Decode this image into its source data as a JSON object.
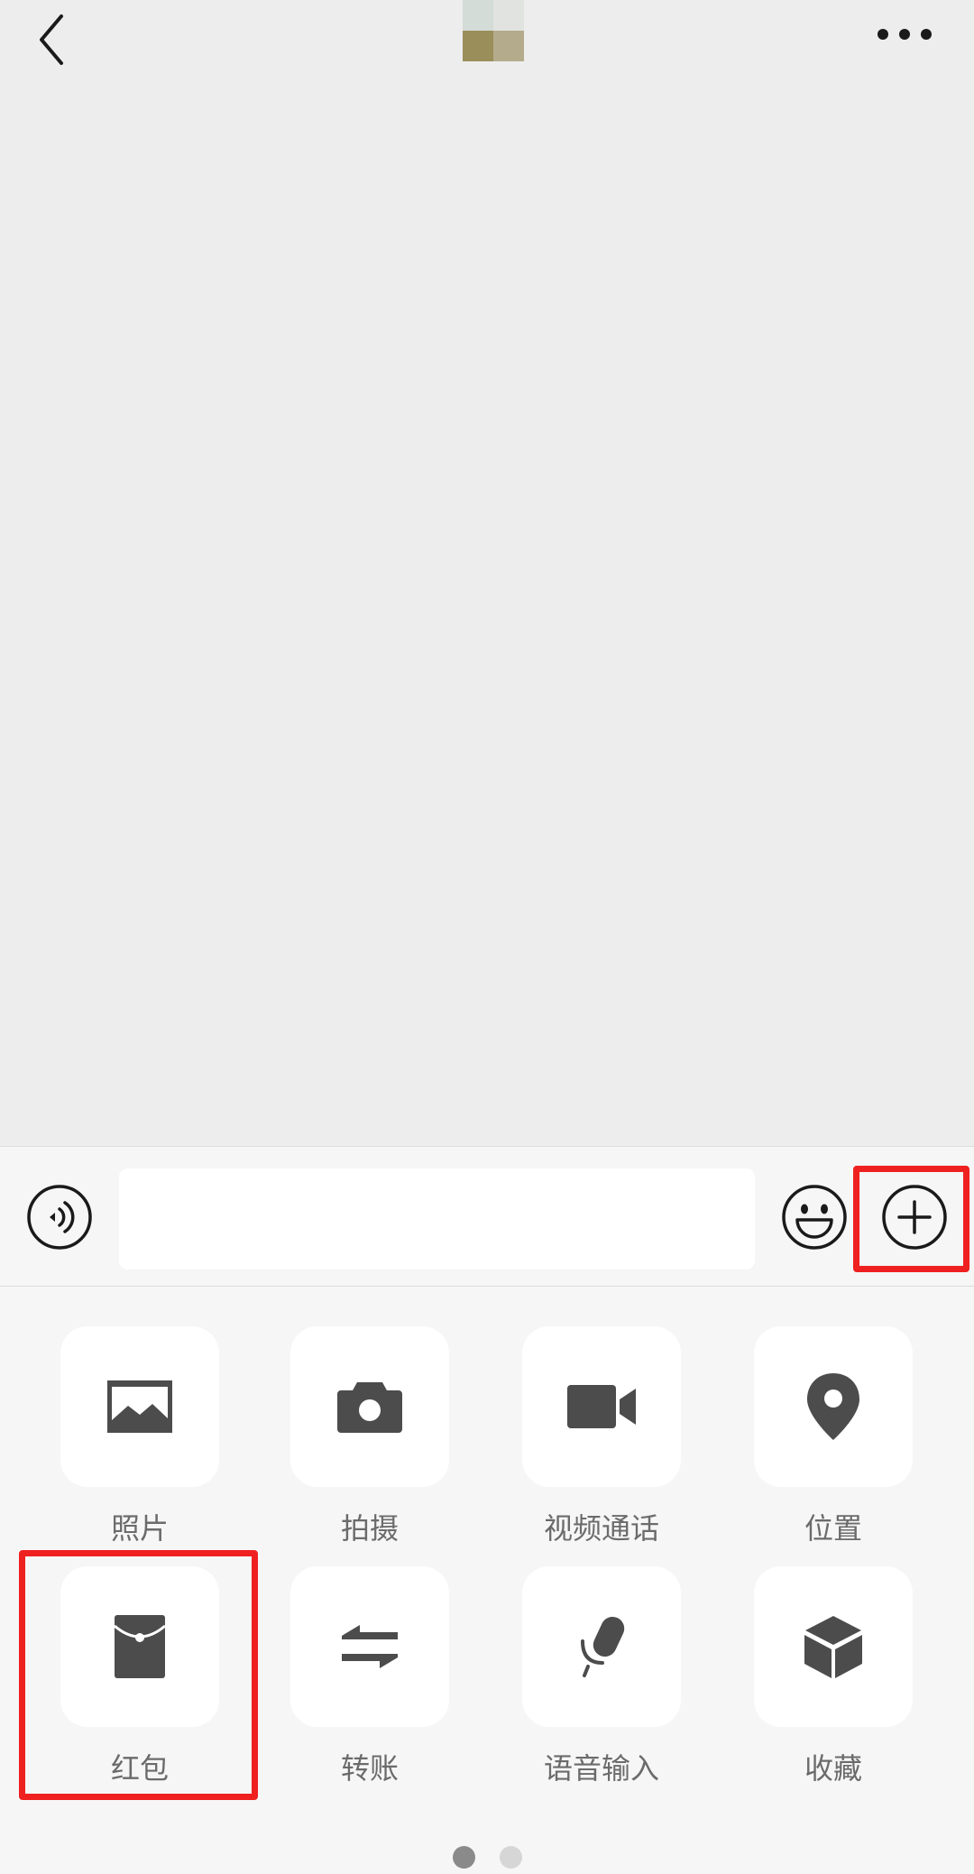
{
  "nav": {
    "back_icon": "chevron-left-icon",
    "more_icon": "ellipsis-icon"
  },
  "input_bar": {
    "message_value": "",
    "message_placeholder": "",
    "voice_icon": "voice-input-icon",
    "emoji_icon": "emoji-icon",
    "plus_icon": "plus-circle-icon"
  },
  "panel": {
    "items": [
      {
        "label": "照片",
        "icon": "photo-icon"
      },
      {
        "label": "拍摄",
        "icon": "camera-icon"
      },
      {
        "label": "视频通话",
        "icon": "video-call-icon"
      },
      {
        "label": "位置",
        "icon": "location-pin-icon"
      },
      {
        "label": "红包",
        "icon": "red-packet-icon"
      },
      {
        "label": "转账",
        "icon": "transfer-icon"
      },
      {
        "label": "语音输入",
        "icon": "microphone-icon"
      },
      {
        "label": "收藏",
        "icon": "favorites-cube-icon"
      }
    ],
    "page_indicator": {
      "current_page": 1,
      "total_pages": 2
    }
  },
  "colors": {
    "chat_background": "#ededed",
    "panel_background": "#f6f6f6",
    "icon_color": "#4c4c4c",
    "label_color": "#6b6b6b",
    "highlight_red": "#ef2020",
    "dot_active": "#8a8a8a",
    "dot_inactive": "#d6d6d6"
  },
  "annotations": {
    "highlighted_elements": [
      "plus-button",
      "panel-item-red-packet"
    ]
  }
}
